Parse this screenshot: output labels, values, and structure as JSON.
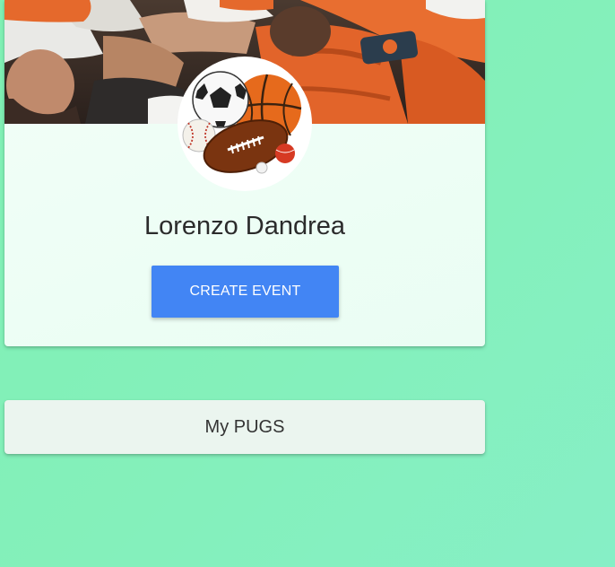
{
  "profile": {
    "name": "Lorenzo Dandrea",
    "cover_image": "rugby-scrum-photo",
    "avatar_image": "sports-balls-icon",
    "create_event_label": "CREATE EVENT"
  },
  "sections": {
    "my_pugs_label": "My PUGS"
  },
  "colors": {
    "background": "#84f0bb",
    "button": "#4285f4",
    "jersey_orange": "#e2642a"
  }
}
